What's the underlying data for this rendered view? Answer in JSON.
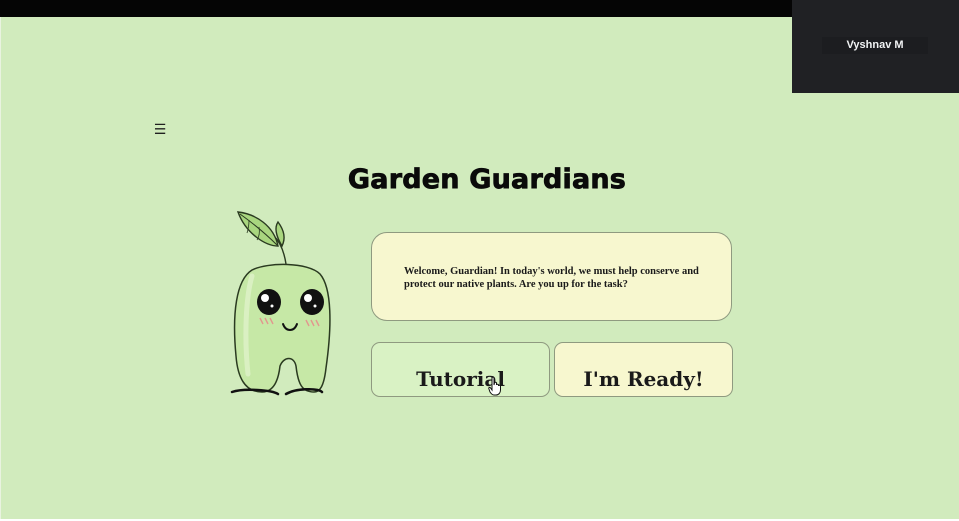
{
  "meeting": {
    "participant_name": "Vyshnav M"
  },
  "nav": {
    "menu_icon": "hamburger-icon",
    "menu_glyph": "☰"
  },
  "page": {
    "title": "Garden Guardians",
    "welcome_message": "Welcome, Guardian! In today's world, we must help conserve and protect our native plants. Are you up for the task?"
  },
  "actions": {
    "tutorial_label": "Tutorial",
    "ready_label": "I'm Ready!"
  },
  "colors": {
    "page_background": "#d1ebbd",
    "message_box": "#f7f7cf",
    "tutorial_button": "#d9f2c4",
    "ready_button": "#f7f7cf",
    "mascot_body": "#c6e8a6"
  }
}
